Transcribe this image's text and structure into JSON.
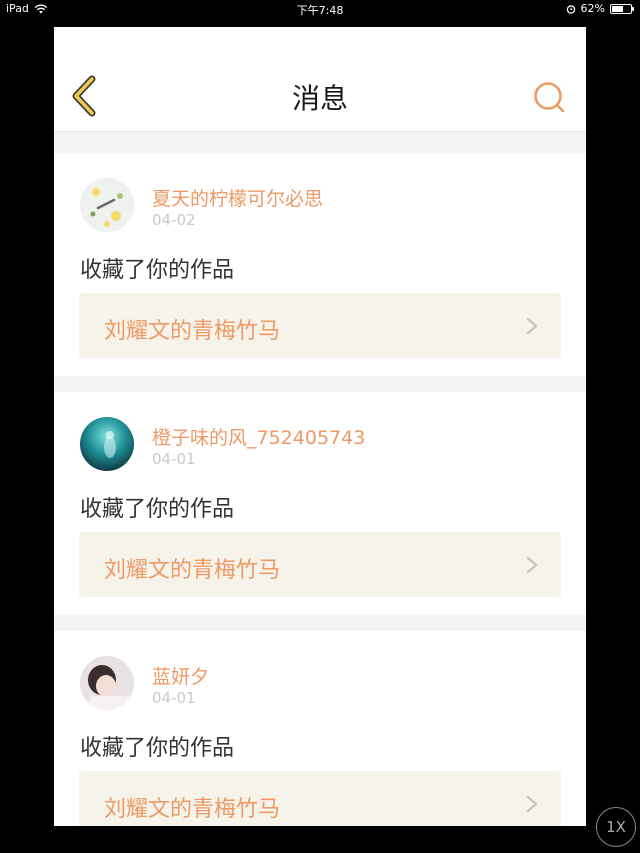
{
  "status_bar": {
    "device": "iPad",
    "time": "下午7:48",
    "battery_percent": "62%",
    "battery_level": 0.62,
    "icons": [
      "wifi-icon",
      "alarm-icon",
      "battery-icon"
    ]
  },
  "nav": {
    "title": "消息",
    "back_icon": "chevron-left-icon",
    "search_icon": "search-icon",
    "accent_color": "#ee9a66"
  },
  "messages": [
    {
      "username": "夏天的柠檬可尔必思",
      "date": "04-02",
      "action": "收藏了你的作品",
      "work_title": "刘耀文的青梅竹马",
      "avatar_icon": "lemon-avatar"
    },
    {
      "username": "橙子味的风_752405743",
      "date": "04-01",
      "action": "收藏了你的作品",
      "work_title": "刘耀文的青梅竹马",
      "avatar_icon": "underwater-avatar"
    },
    {
      "username": "蓝妍夕",
      "date": "04-01",
      "action": "收藏了你的作品",
      "work_title": "刘耀文的青梅竹马",
      "avatar_icon": "portrait-avatar"
    }
  ],
  "zoom_badge": "1X"
}
